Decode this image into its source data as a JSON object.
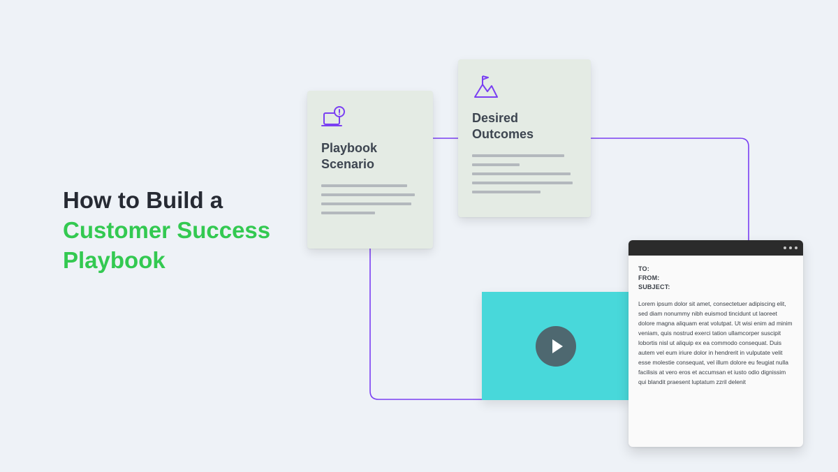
{
  "headline": {
    "line1": "How to Build a",
    "line2a": "Customer Success",
    "line2b": "Playbook"
  },
  "cards": {
    "scenario": {
      "title": "Playbook Scenario"
    },
    "outcomes": {
      "title": "Desired Outcomes"
    }
  },
  "email": {
    "to_label": "TO:",
    "from_label": "FROM:",
    "subject_label": "SUBJECT:",
    "body": "Lorem ipsum dolor sit amet, consectetuer adipiscing elit, sed diam nonummy nibh euismod tincidunt ut laoreet dolore magna aliquam erat volutpat. Ut wisi enim ad minim veniam, quis nostrud exerci tation ullamcorper suscipit lobortis nisl ut aliquip ex ea commodo consequat. Duis autem vel eum iriure dolor in hendrerit in vulputate velit esse molestie consequat, vel illum dolore eu feugiat nulla facilisis at vero eros et accumsan et iusto odio dignissim qui blandit praesent luptatum zzril delenit"
  },
  "colors": {
    "accent_green": "#33c951",
    "connector_purple": "#7a3ff2",
    "card_bg": "#e4ebe4",
    "video_bg": "#48d8da"
  }
}
